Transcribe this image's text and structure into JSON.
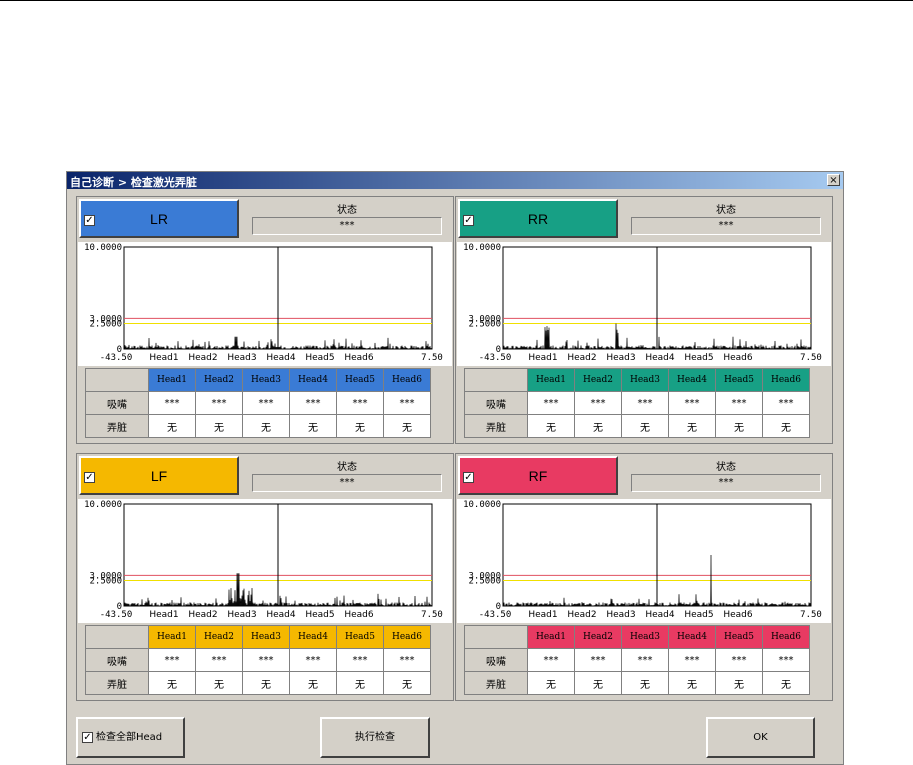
{
  "window": {
    "title": "自己诊断 > 检查激光弄脏",
    "close_glyph": "×"
  },
  "status_label": "状态",
  "status_value": "***",
  "row_labels": {
    "suction": "吸嘴",
    "dirty": "弄脏"
  },
  "checkbox_mark": "✓",
  "panels": [
    {
      "id": "LR",
      "name": "LR",
      "color": "#3a7bd5",
      "heads": [
        "Head1",
        "Head2",
        "Head3",
        "Head4",
        "Head5",
        "Head6"
      ],
      "suction": [
        "***",
        "***",
        "***",
        "***",
        "***",
        "***"
      ],
      "dirty": [
        "无",
        "无",
        "无",
        "无",
        "无",
        "无"
      ]
    },
    {
      "id": "RR",
      "name": "RR",
      "color": "#17a085",
      "heads": [
        "Head1",
        "Head2",
        "Head3",
        "Head4",
        "Head5",
        "Head6"
      ],
      "suction": [
        "***",
        "***",
        "***",
        "***",
        "***",
        "***"
      ],
      "dirty": [
        "无",
        "无",
        "无",
        "无",
        "无",
        "无"
      ]
    },
    {
      "id": "LF",
      "name": "LF",
      "color": "#f5b800",
      "heads": [
        "Head1",
        "Head2",
        "Head3",
        "Head4",
        "Head5",
        "Head6"
      ],
      "suction": [
        "***",
        "***",
        "***",
        "***",
        "***",
        "***"
      ],
      "dirty": [
        "无",
        "无",
        "无",
        "无",
        "无",
        "无"
      ]
    },
    {
      "id": "RF",
      "name": "RF",
      "color": "#e83a62",
      "heads": [
        "Head1",
        "Head2",
        "Head3",
        "Head4",
        "Head5",
        "Head6"
      ],
      "suction": [
        "***",
        "***",
        "***",
        "***",
        "***",
        "***"
      ],
      "dirty": [
        "无",
        "无",
        "无",
        "无",
        "无",
        "无"
      ]
    }
  ],
  "chart_axis": {
    "y_ticks": [
      "10.0000",
      "3.0000",
      "2.5000",
      "0"
    ],
    "x_min_label": "-43.50",
    "x_max_label": "7.50",
    "x_heads": [
      "Head1",
      "Head2",
      "Head3",
      "Head4",
      "Head5",
      "Head6"
    ],
    "ylim": [
      0,
      10
    ],
    "xlim": [
      -43.5,
      7.5
    ],
    "threshold_red": 3.0,
    "threshold_yellow": 2.5,
    "line_red": "#e05060",
    "line_yellow": "#f0e000"
  },
  "bottom": {
    "check_all_label": "检查全部Head",
    "execute_label": "执行检查",
    "ok_label": "OK"
  }
}
